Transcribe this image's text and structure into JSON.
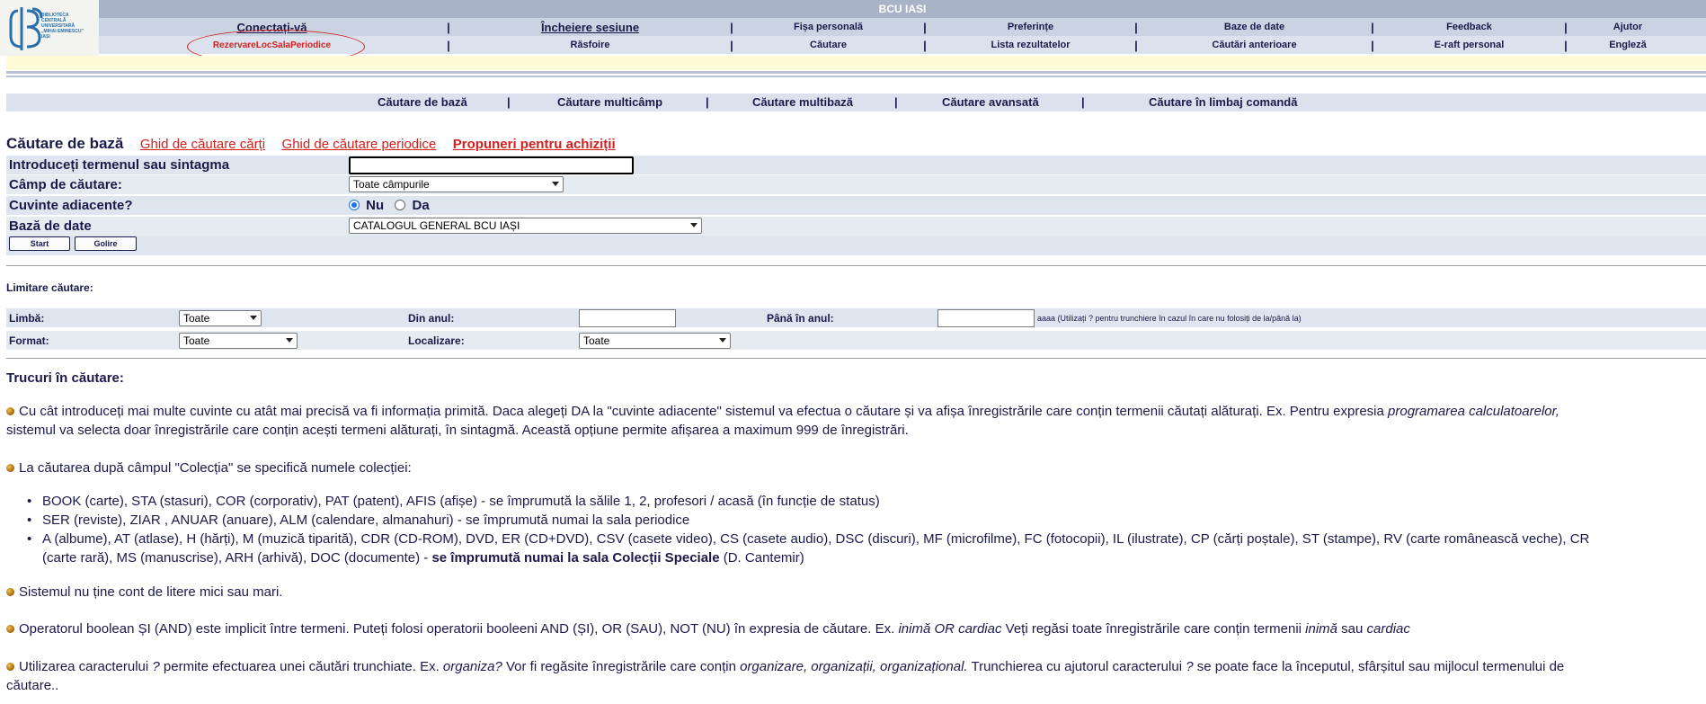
{
  "header": {
    "title": "BCU IASI",
    "logo_text": [
      "BIBLIOTECA",
      "CENTRALĂ",
      "UNIVERSITARĂ",
      "„MIHAI EMINESCU”",
      "IAȘI"
    ],
    "nav_row_1": [
      "Conectați-vă",
      "Încheiere sesiune",
      "Fișa personală",
      "Preferințe",
      "Baze de date",
      "Feedback",
      "Ajutor"
    ],
    "nav_row_2": [
      "RezervareLocSalaPeriodice",
      "Răsfoire",
      "Căutare",
      "Lista rezultatelor",
      "Căutări anterioare",
      "E-raft personal",
      "Engleză"
    ]
  },
  "search_tabs": [
    "Căutare de bază",
    "Căutare multicâmp",
    "Căutare multibază",
    "Căutare avansată",
    "Căutare în limbaj comandă"
  ],
  "heading": {
    "title": "Căutare de bază",
    "links": [
      "Ghid de căutare cărți",
      "Ghid de căutare periodice",
      "Propuneri pentru achiziții"
    ]
  },
  "form": {
    "term_label": "Introduceți termenul sau sintagma",
    "term_value": "",
    "field_label": "Câmp de căutare:",
    "field_value": "Toate câmpurile",
    "adjacent_label": "Cuvinte adiacente?",
    "adjacent_no": "Nu",
    "adjacent_yes": "Da",
    "adjacent_selected": "Nu",
    "db_label": "Bază de date",
    "db_value": "CATALOGUL GENERAL BCU IAȘI",
    "start_button": "Start",
    "clear_button": "Golire"
  },
  "limit": {
    "title": "Limitare căutare:",
    "language_label": "Limbă:",
    "language_value": "Toate",
    "from_year_label": "Din anul:",
    "from_year_value": "",
    "to_year_label": "Până în anul:",
    "to_year_value": "",
    "year_hint": "aaaa (Utilizați ? pentru trunchiere în cazul în care nu folosiți de la/până la)",
    "format_label": "Format:",
    "format_value": "Toate",
    "location_label": "Localizare:",
    "location_value": "Toate"
  },
  "tips": {
    "title": "Trucuri în căutare:",
    "tip1_a": "Cu cât introduceți mai multe cuvinte cu atât mai precisă va fi informația primită. Daca alegeți DA la \"cuvinte adiacente\" sistemul va efectua o căutare și va afișa înregistrările care conțin termenii căutați alăturați. Ex. Pentru expresia ",
    "tip1_em": "programarea calculatoarelor,",
    "tip1_b": "sistemul va selecta doar înregistrările care conțin acești termeni alăturați, în sintagmă. Această opțiune permite afișarea a maximum 999 de înregistrări.",
    "tip2": "La căutarea după câmpul \"Colecția\" se specifică numele colecției:",
    "collections": [
      "BOOK (carte), STA (stasuri), COR (corporativ), PAT (patent), AFIS (afișe) - se împrumută la sălile 1, 2, profesori / acasă (în funcție de status)",
      "SER (reviste), ZIAR , ANUAR (anuare), ALM (calendare, almanahuri) - se împrumută numai la sala periodice"
    ],
    "collection3_a": "A (albume), AT (atlase), H (hărți), M (muzică tiparită), CDR (CD-ROM), DVD, ER (CD+DVD), CSV (casete video), CS (casete audio), DSC (discuri), MF (microfilme), FC (fotocopii), IL (ilustrate), CP (cărți poștale), ST (stampe), RV (carte românească veche), CR",
    "collection3_b": "(carte rară), MS (manuscrise), ARH (arhivă), DOC (documente) - ",
    "collection3_bold": "se împrumută numai la sala Colecții Speciale",
    "collection3_c": " (D. Cantemir)",
    "tip3": "Sistemul nu ține cont de litere mici sau mari.",
    "tip4_a": "Operatorul boolean ȘI (AND) este implicit între termeni. Puteți folosi operatorii booleeni AND (ȘI), OR (SAU), NOT (NU) în expresia de căutare. Ex. ",
    "tip4_em1": "inimă OR cardiac",
    "tip4_b": " Veți regăsi toate înregistrările care conțin termenii ",
    "tip4_em2": "inimă",
    "tip4_c": " sau ",
    "tip4_em3": "cardiac",
    "tip5_a": "Utilizarea caracterului ",
    "tip5_em1": "?",
    "tip5_b": " permite efectuarea unei căutări trunchiate. Ex. ",
    "tip5_em2": "organiza?",
    "tip5_c": " Vor fi regăsite înregistrările care conțin ",
    "tip5_em3": "organizare, organizații, organizațional.",
    "tip5_d": " Trunchierea cu ajutorul caracterului ",
    "tip5_em4": "?",
    "tip5_e": " se poate face la începutul, sfârșitul sau mijlocul termenului de",
    "tip5_f": "căutare.."
  },
  "colors": {
    "accent_red": "#d3201f",
    "nav_blue": "#c9d3e2",
    "band_yellow": "#fffbd6"
  }
}
